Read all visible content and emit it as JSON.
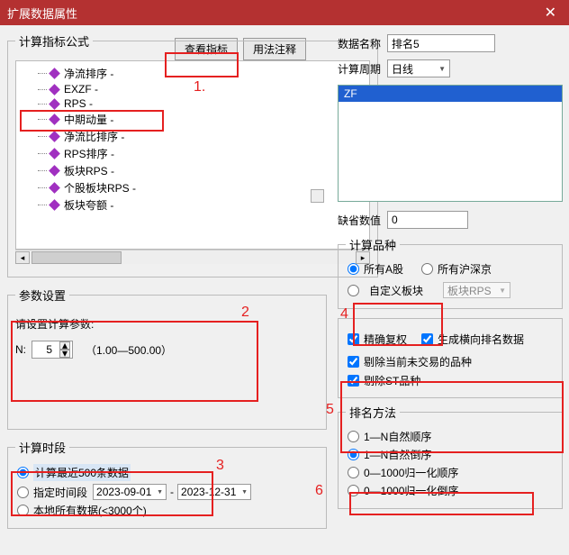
{
  "title": "扩展数据属性",
  "buttons": {
    "view_indicator": "查看指标",
    "usage_notes": "用法注释"
  },
  "left": {
    "formula_title": "计算指标公式",
    "tree": [
      "净流排序 -",
      "EXZF -",
      "RPS -",
      "中期动量 -",
      "净流比排序 -",
      "RPS排序 -",
      "板块RPS -",
      "个股板块RPS -",
      "板块夸额 -"
    ],
    "param_title": "参数设置",
    "param_prompt": "请设置计算参数:",
    "param_n_label": "N:",
    "param_n_value": "5",
    "param_range": "（1.00—500.00）",
    "period_title": "计算时段",
    "period_opts": {
      "recent": "计算最近500条数据",
      "range": "指定时间段",
      "local": "本地所有数据"
    },
    "date_from": "2023-09-01",
    "date_to": "2023-12-31",
    "local_note": "(<3000个)"
  },
  "right": {
    "data_name_label": "数据名称",
    "data_name_value": "排名5",
    "cycle_label": "计算周期",
    "cycle_value": "日线",
    "list_item": "ZF",
    "default_label": "缺省数值",
    "default_value": "0",
    "variety": {
      "title": "计算品种",
      "all_a": "所有A股",
      "all_hsg": "所有沪深京",
      "custom": "自定义板块",
      "custom_sel": "板块RPS"
    },
    "checks": {
      "fq": "精确复权",
      "rank": "生成横向排名数据",
      "notrade": "剔除当前未交易的品种",
      "st": "剔除ST品种"
    },
    "method": {
      "title": "排名方法",
      "o1": "1—N自然顺序",
      "o2": "1—N自然倒序",
      "o3": "0—1000归一化顺序",
      "o4": "0—1000归一化倒序"
    }
  },
  "steps": {
    "s1": "1.",
    "s2": "2",
    "s3": "3",
    "s4": "4",
    "s5": "5",
    "s6": "6"
  }
}
